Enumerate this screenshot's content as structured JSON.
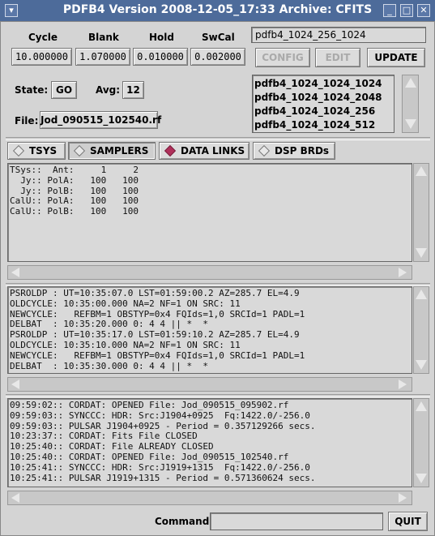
{
  "window": {
    "title": "PDFB4  Version 2008-12-05_17:33  Archive: CFITS",
    "minimize_label": "_",
    "maximize_label": "□",
    "close_label": "✕"
  },
  "params": {
    "cycle_label": "Cycle",
    "blank_label": "Blank",
    "hold_label": "Hold",
    "swcal_label": "SwCal",
    "cycle_value": "10.000000",
    "blank_value": "1.070000",
    "hold_value": "0.010000",
    "swcal_value": "0.002000"
  },
  "config_name": "pdfb4_1024_256_1024",
  "buttons": {
    "config": "CONFIG",
    "edit": "EDIT",
    "update": "UPDATE",
    "quit": "QUIT"
  },
  "state": {
    "state_label": "State:",
    "state_value": "GO",
    "avg_label": "Avg:",
    "avg_value": "12",
    "file_label": "File:",
    "file_value": "Jod_090515_102540.rf"
  },
  "config_list": [
    "pdfb4_1024_1024_1024",
    "pdfb4_1024_1024_2048",
    "pdfb4_1024_1024_256",
    "pdfb4_1024_1024_512"
  ],
  "tabs": [
    {
      "label": "TSYS",
      "selected": false
    },
    {
      "label": "SAMPLERS",
      "selected": false
    },
    {
      "label": "DATA LINKS",
      "selected": true
    },
    {
      "label": "DSP BRDs",
      "selected": false
    }
  ],
  "tsys_panel": [
    "TSys::  Ant:     1     2",
    "  Jy:: PolA:   100   100",
    "  Jy:: PolB:   100   100",
    "CalU:: PolA:   100   100",
    "CalU:: PolB:   100   100"
  ],
  "status_panel": [
    "PSROLDP : UT=10:35:07.0 LST=01:59:00.2 AZ=285.7 EL=4.9",
    "OLDCYCLE: 10:35:00.000 NA=2 NF=1 ON SRC: 11",
    "NEWCYCLE:   REFBM=1 OBSTYP=0x4 FQIds=1,0 SRCId=1 PADL=1",
    "DELBAT  : 10:35:20.000 0: 4 4 || *  *",
    "PSROLDP : UT=10:35:17.0 LST=01:59:10.2 AZ=285.7 EL=4.9",
    "OLDCYCLE: 10:35:10.000 NA=2 NF=1 ON SRC: 11",
    "NEWCYCLE:   REFBM=1 OBSTYP=0x4 FQIds=1,0 SRCId=1 PADL=1",
    "DELBAT  : 10:35:30.000 0: 4 4 || *  *"
  ],
  "log_panel": [
    "09:59:02:: CORDAT: OPENED File: Jod_090515_095902.rf",
    "09:59:03:: SYNCCC: HDR: Src:J1904+0925  Fq:1422.0/-256.0",
    "09:59:03:: PULSAR J1904+0925 - Period = 0.357129266 secs.",
    "10:23:37:: CORDAT: Fits File CLOSED",
    "10:25:40:: CORDAT: File ALREADY CLOSED",
    "10:25:40:: CORDAT: OPENED File: Jod_090515_102540.rf",
    "10:25:41:: SYNCCC: HDR: Src:J1919+1315  Fq:1422.0/-256.0",
    "10:25:41:: PULSAR J1919+1315 - Period = 0.571360624 secs."
  ],
  "command": {
    "label": "Command:",
    "value": ""
  },
  "colors": {
    "titlebar": "#4d6b9a",
    "window_bg": "#d4d4d4",
    "selected_tab_marker": "#b0305a"
  }
}
